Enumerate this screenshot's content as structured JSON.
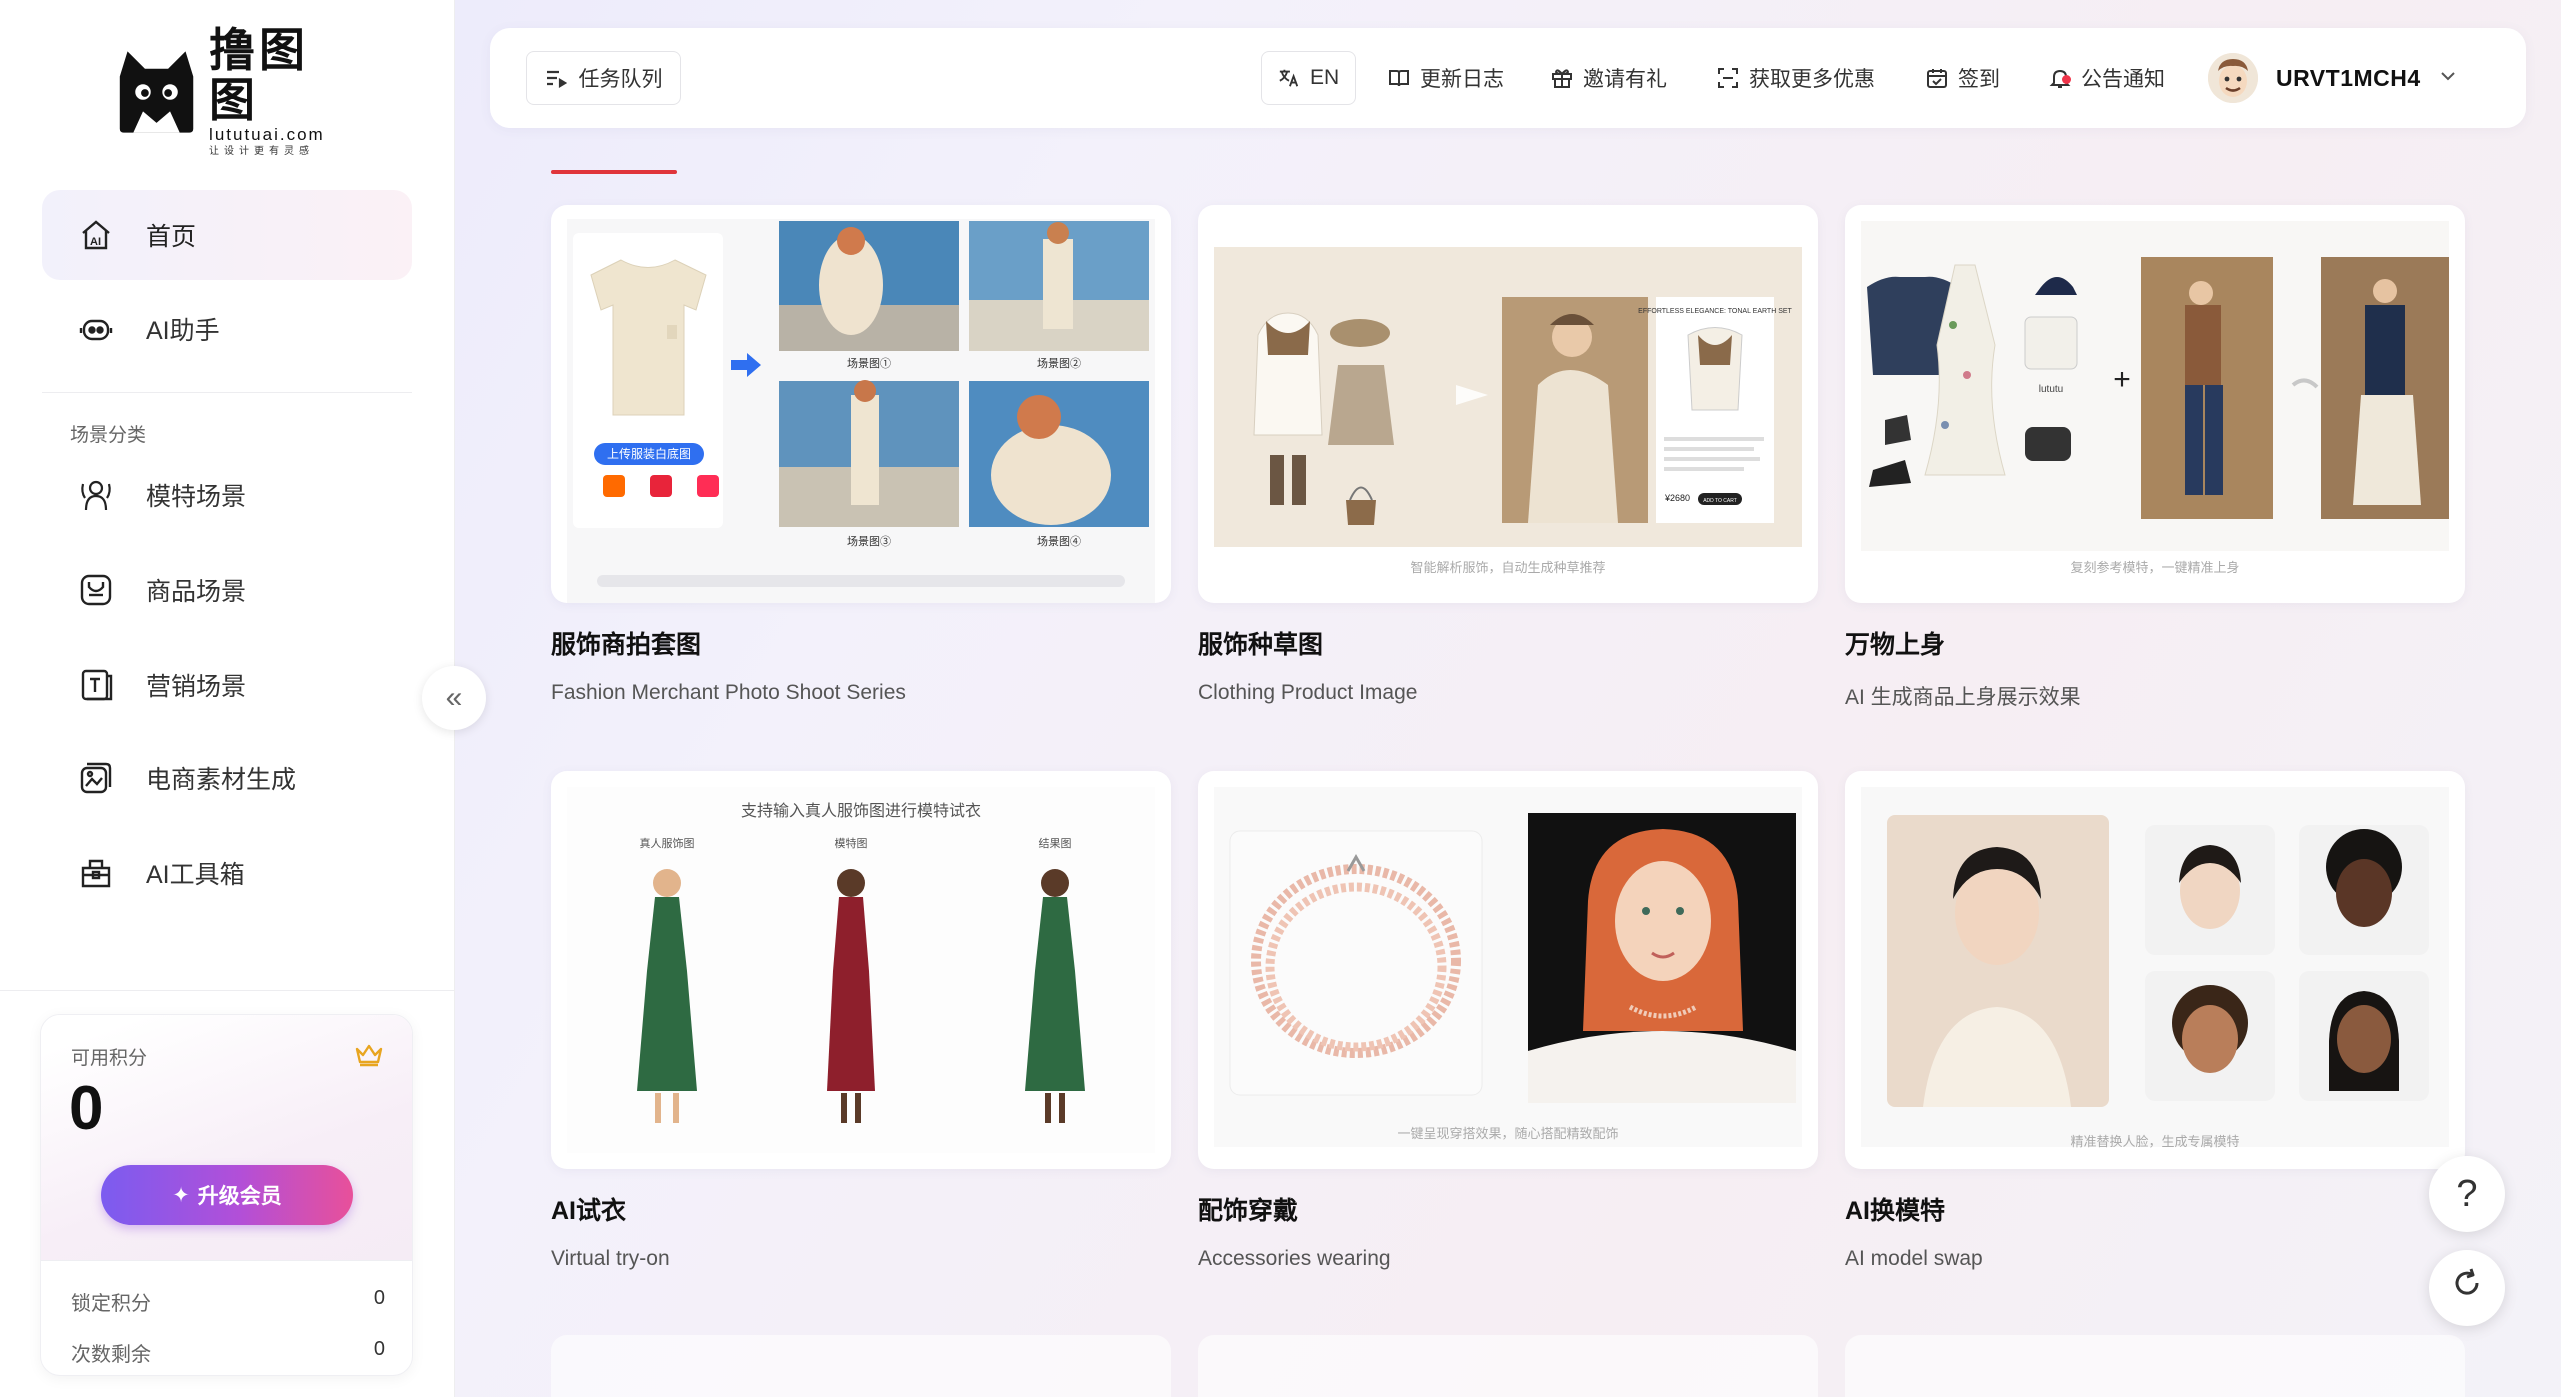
{
  "brand": {
    "name": "撸图图",
    "domain": "lututuai.com",
    "slogan": "让设计更有灵感"
  },
  "sidebar": {
    "items": [
      {
        "label": "首页",
        "icon": "home-ai-icon",
        "active": true
      },
      {
        "label": "AI助手",
        "icon": "robot-icon",
        "active": false
      }
    ],
    "section_title": "场景分类",
    "scenes": [
      {
        "label": "模特场景",
        "icon": "model-icon"
      },
      {
        "label": "商品场景",
        "icon": "product-bag-icon"
      },
      {
        "label": "营销场景",
        "icon": "marketing-icon"
      },
      {
        "label": "电商素材生成",
        "icon": "ecommerce-material-icon"
      },
      {
        "label": "AI工具箱",
        "icon": "toolbox-icon"
      }
    ]
  },
  "credits": {
    "label": "可用积分",
    "value": "0",
    "upgrade_label": "升级会员",
    "locked_label": "锁定积分",
    "locked_value": "0",
    "remaining_label": "次数剩余",
    "remaining_value": "0"
  },
  "header": {
    "task_queue": "任务队列",
    "language": "EN",
    "changelog": "更新日志",
    "invite": "邀请有礼",
    "offers": "获取更多优惠",
    "checkin": "签到",
    "notice": "公告通知",
    "username": "URVT1MCH4"
  },
  "cards": [
    {
      "title": "服饰商拍套图",
      "desc": "Fashion Merchant Photo Shoot Series",
      "upload_btn": "上传服装白底图",
      "scene_labels": [
        "场景图①",
        "场景图②",
        "场景图③",
        "场景图④"
      ]
    },
    {
      "title": "服饰种草图",
      "desc": "Clothing Product Image",
      "caption": "智能解析服饰，自动生成种草推荐",
      "promo_title": "EFFORTLESS ELEGANCE: TONAL EARTH SET",
      "promo_price": "¥2680",
      "promo_btn": "ADD TO CART"
    },
    {
      "title": "万物上身",
      "desc": "AI 生成商品上身展示效果",
      "caption": "复刻参考模特，一键精准上身",
      "bag_brand": "lututu"
    },
    {
      "title": "AI试衣",
      "desc": "Virtual try-on",
      "heading": "支持输入真人服饰图进行模特试衣",
      "col_labels": [
        "真人服饰图",
        "模特图",
        "结果图"
      ]
    },
    {
      "title": "配饰穿戴",
      "desc": "Accessories wearing",
      "caption": "一键呈现穿搭效果，随心搭配精致配饰"
    },
    {
      "title": "AI换模特",
      "desc": "AI model swap",
      "caption": "精准替换人脸，生成专属模特"
    }
  ],
  "colors": {
    "accent_red": "#e0353b",
    "upgrade_gradient_start": "#7b5cf0",
    "upgrade_gradient_end": "#e8509a",
    "blue_button": "#2f6ff0"
  },
  "floating": {
    "help": "?",
    "refresh_icon": "refresh-icon"
  }
}
